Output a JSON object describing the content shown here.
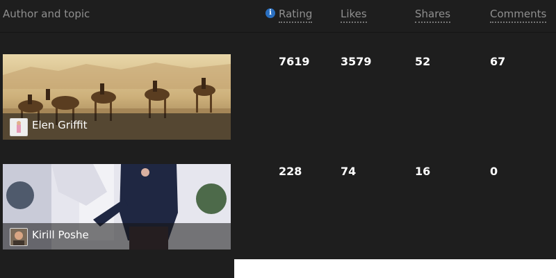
{
  "header": {
    "author_topic": "Author and topic",
    "rating": "Rating",
    "likes": "Likes",
    "shares": "Shares",
    "comments": "Comments",
    "info_icon": "info-icon"
  },
  "rows": [
    {
      "author": "Elen Griffit",
      "rating": "7619",
      "likes": "3579",
      "shares": "52",
      "comments": "67"
    },
    {
      "author": "Kirill Poshe",
      "rating": "228",
      "likes": "74",
      "shares": "16",
      "comments": "0"
    }
  ],
  "colors": {
    "background": "#1e1e1e",
    "info_icon": "#2a6fc0",
    "header_text": "#8f8f8f"
  }
}
